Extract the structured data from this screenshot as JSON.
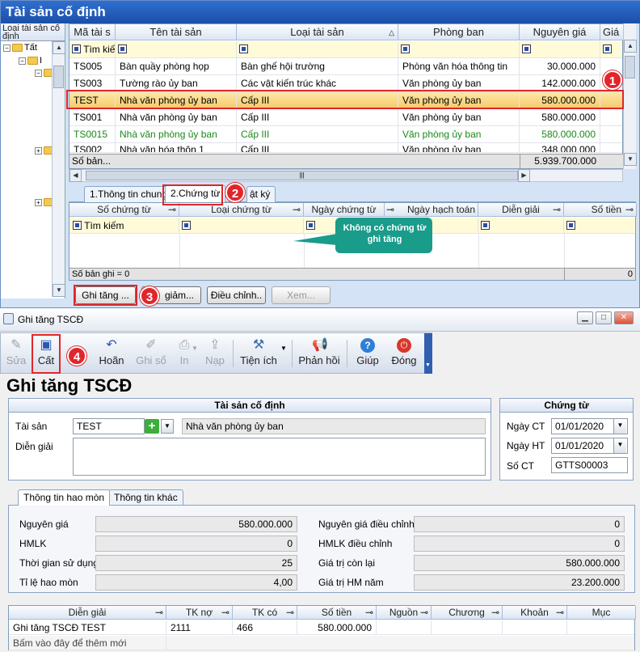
{
  "top_panel": {
    "title": "Tài sản cố định",
    "tree_header": "Loại tài sản cố định",
    "tree_root": "Tất",
    "tree_child": "I",
    "grid": {
      "columns": [
        "Mã tài s",
        "Tên tài sản",
        "Loại tài sản",
        "Phòng ban",
        "Nguyên giá",
        "Giá"
      ],
      "filter_label": "Tìm kiếm",
      "rows": [
        {
          "code": "TS005",
          "name": "Bàn quầy phòng họp",
          "type": "Bàn ghế hội trường",
          "dept": "Phòng văn hóa thông tin",
          "cost": "30.000.000"
        },
        {
          "code": "TS003",
          "name": "Tường rào ủy ban",
          "type": "Các vật kiến trúc khác",
          "dept": "Văn phòng ủy ban",
          "cost": "142.000.000"
        },
        {
          "code": "TEST",
          "name": "Nhà văn phòng ủy ban",
          "type": "Cấp III",
          "dept": "Văn phòng ủy ban",
          "cost": "580.000.000"
        },
        {
          "code": "TS001",
          "name": "Nhà văn phòng ủy ban",
          "type": "Cấp III",
          "dept": "Văn phòng ủy ban",
          "cost": "580.000.000"
        },
        {
          "code": "TS0015",
          "name": "Nhà văn phòng ủy ban",
          "type": "Cấp III",
          "dept": "Văn phòng ủy ban",
          "cost": "580.000.000"
        },
        {
          "code": "TS002",
          "name": "Nhà văn hóa thôn 1",
          "type": "Cấp III",
          "dept": "Văn phòng ủy ban",
          "cost": "348.000.000"
        }
      ],
      "footer_label": "Số bản...",
      "footer_total": "5.939.700.000"
    },
    "tabs": [
      "1.Thông tin chung",
      "2.Chứng từ",
      "3.Nhật ký"
    ],
    "tab3_visible": "ật ký",
    "sub_grid": {
      "columns": [
        "Số chứng từ",
        "Loại chứng từ",
        "Ngày chứng từ",
        "Ngày hạch toán",
        "Diễn giải",
        "Số tiền"
      ],
      "filter_label": "Tìm kiếm",
      "footer_label": "Số bản ghi = 0",
      "footer_total": "0"
    },
    "callout": "Không có chứng từ ghi tăng",
    "buttons": {
      "increase": "Ghi tăng ...",
      "decrease": "Ghi giảm...",
      "decrease_visible": "giảm...",
      "adjust": "Điều chỉnh..",
      "view": "Xem..."
    },
    "badges": [
      "1",
      "2",
      "3",
      "4"
    ]
  },
  "dialog": {
    "title": "Ghi tăng TSCĐ",
    "toolbar": {
      "edit": "Sửa",
      "save": "Cất",
      "undo": "Hoãn",
      "post": "Ghi sổ",
      "print": "In",
      "load": "Nạp",
      "utilities": "Tiện ích",
      "feedback": "Phản hồi",
      "help": "Giúp",
      "close": "Đóng"
    },
    "heading": "Ghi tăng TSCĐ",
    "asset_section": {
      "header": "Tài sản cố định",
      "asset_label": "Tài sản",
      "asset_code": "TEST",
      "asset_name": "Nhà văn phòng ủy ban",
      "desc_label": "Diễn giải",
      "desc_value": ""
    },
    "voucher_section": {
      "header": "Chứng từ",
      "date_ct_label": "Ngày CT",
      "date_ct": "01/01/2020",
      "date_ht_label": "Ngày HT",
      "date_ht": "01/01/2020",
      "no_label": "Số CT",
      "no": "GTTS00003"
    },
    "info_tabs": [
      "Thông tin hao mòn",
      "Thông tin khác"
    ],
    "depreciation": {
      "cost_label": "Nguyên giá",
      "cost": "580.000.000",
      "hmlk_label": "HMLK",
      "hmlk": "0",
      "life_label": "Thời gian sử dụng",
      "life": "25",
      "rate_label": "Tỉ lệ hao mòn",
      "rate": "4,00",
      "cost_adj_label": "Nguyên giá điều chỉnh",
      "cost_adj": "0",
      "hmlk_adj_label": "HMLK điều chỉnh",
      "hmlk_adj": "0",
      "remain_label": "Giá trị còn lại",
      "remain": "580.000.000",
      "annual_label": "Giá trị HM năm",
      "annual": "23.200.000"
    },
    "entries": {
      "columns": [
        "Diễn giải",
        "TK nợ",
        "TK có",
        "Số tiền",
        "Nguồn",
        "Chương",
        "Khoản",
        "Mục"
      ],
      "rows": [
        {
          "desc": "Ghi tăng TSCĐ TEST",
          "debit": "2111",
          "credit": "466",
          "amount": "580.000.000"
        }
      ],
      "add_hint": "Bấm vào đây để thêm mới"
    }
  }
}
